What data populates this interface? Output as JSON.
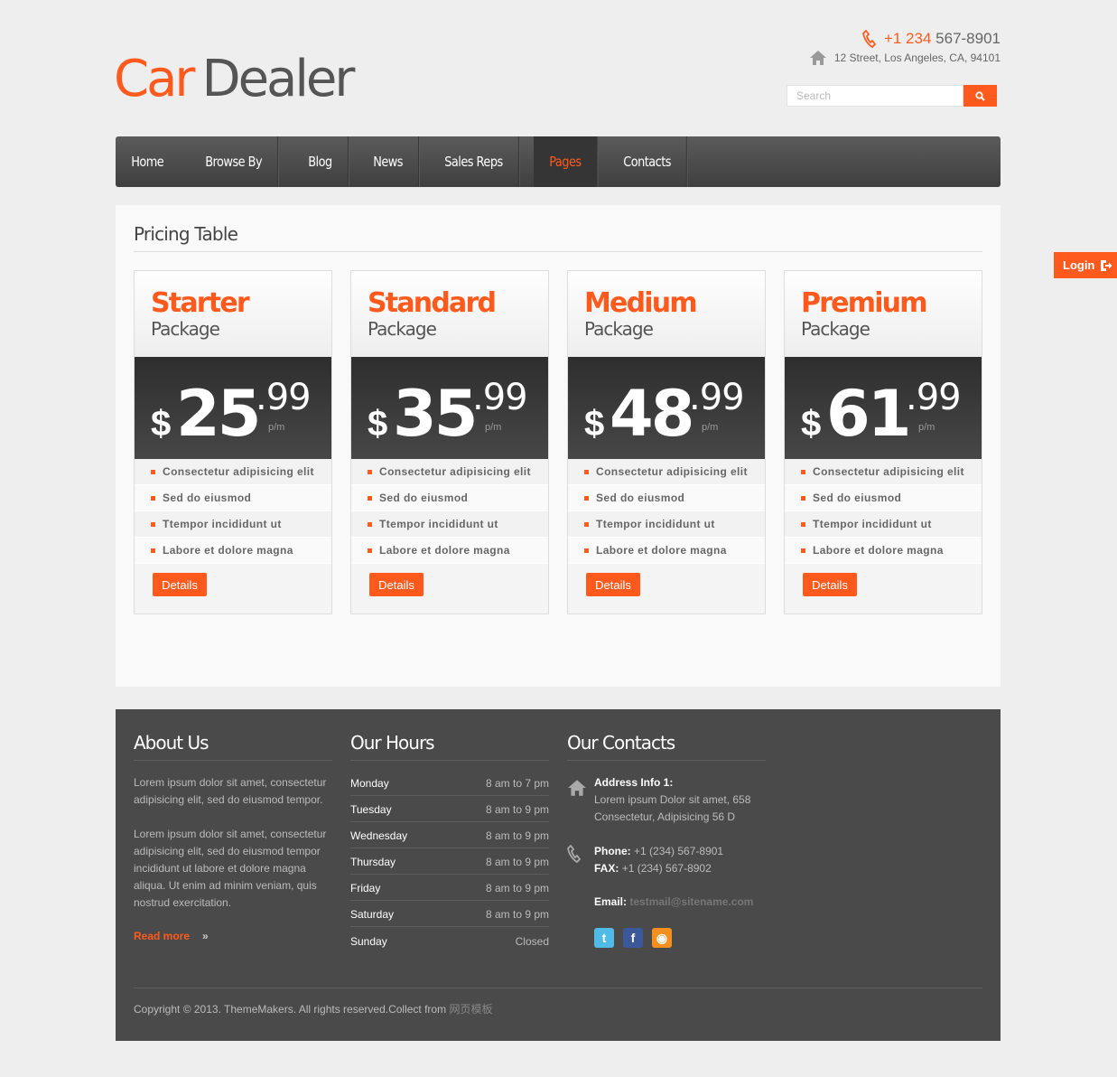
{
  "header": {
    "logo_part1": "Car",
    "logo_part2": "Dealer",
    "phone_code": "+1 234",
    "phone_number": "567-8901",
    "address": "12 Street, Los Angeles, CA, 94101",
    "search_placeholder": "Search"
  },
  "colors": {
    "accent": "#ff5a1d",
    "nav_bg": "#4a4a4a",
    "footer_bg": "#4a4a4a"
  },
  "nav": {
    "items": [
      {
        "label": "Home"
      },
      {
        "label": "Browse By"
      },
      {
        "label": "Blog"
      },
      {
        "label": "News"
      },
      {
        "label": "Sales Reps"
      },
      {
        "label": "Pages",
        "active": true
      },
      {
        "label": "Contacts"
      }
    ]
  },
  "login_label": "Login",
  "main": {
    "title": "Pricing Table",
    "plans": [
      {
        "name": "Starter",
        "sub": "Package",
        "currency": "$",
        "price": "25",
        "cents": ".99",
        "period": "p/m",
        "features": [
          "Consectetur adipisicing elit",
          "Sed do eiusmod",
          "Ttempor incididunt ut",
          "Labore et dolore magna"
        ],
        "button": "Details"
      },
      {
        "name": "Standard",
        "sub": "Package",
        "currency": "$",
        "price": "35",
        "cents": ".99",
        "period": "p/m",
        "features": [
          "Consectetur adipisicing elit",
          "Sed do eiusmod",
          "Ttempor incididunt ut",
          "Labore et dolore magna"
        ],
        "button": "Details"
      },
      {
        "name": "Medium",
        "sub": "Package",
        "currency": "$",
        "price": "48",
        "cents": ".99",
        "period": "p/m",
        "features": [
          "Consectetur adipisicing elit",
          "Sed do eiusmod",
          "Ttempor incididunt ut",
          "Labore et dolore magna"
        ],
        "button": "Details"
      },
      {
        "name": "Premium",
        "sub": "Package",
        "currency": "$",
        "price": "61",
        "cents": ".99",
        "period": "p/m",
        "features": [
          "Consectetur adipisicing elit",
          "Sed do eiusmod",
          "Ttempor incididunt ut",
          "Labore et dolore magna"
        ],
        "button": "Details"
      }
    ]
  },
  "footer": {
    "about": {
      "title": "About Us",
      "p1": "Lorem ipsum dolor sit amet, consectetur adipisicing elit, sed do eiusmod tempor.",
      "p2": "Lorem ipsum dolor sit amet, consectetur adipisicing elit, sed do eiusmod tempor incididunt ut labore et dolore magna aliqua. Ut enim ad minim veniam, quis nostrud exercitation.",
      "read_more": "Read more"
    },
    "hours": {
      "title": "Our Hours",
      "rows": [
        {
          "day": "Monday",
          "time": "8 am to 7 pm"
        },
        {
          "day": "Tuesday",
          "time": "8 am to 9 pm"
        },
        {
          "day": "Wednesday",
          "time": "8 am to 9 pm"
        },
        {
          "day": "Thursday",
          "time": "8 am to 9 pm"
        },
        {
          "day": "Friday",
          "time": "8 am to 9 pm"
        },
        {
          "day": "Saturday",
          "time": "8 am to 9 pm"
        },
        {
          "day": "Sunday",
          "time": "Closed"
        }
      ]
    },
    "contacts": {
      "title": "Our Contacts",
      "address_label": "Address Info 1:",
      "address_line1": "Lorem ipsum Dolor sit amet, 658",
      "address_line2": "Consectetur, Adipisicing 56 D",
      "phone_label": "Phone:",
      "phone": "+1 (234) 567-8901",
      "fax_label": "FAX:",
      "fax": "+1 (234) 567-8902",
      "email_label": "Email:",
      "email": "testmail@sitename.com",
      "social": [
        "twitter-icon",
        "facebook-icon",
        "rss-icon"
      ]
    },
    "copyright": "Copyright © 2013. ThemeMakers.  All rights reserved.Collect from",
    "copyright_link": "网页模板"
  }
}
